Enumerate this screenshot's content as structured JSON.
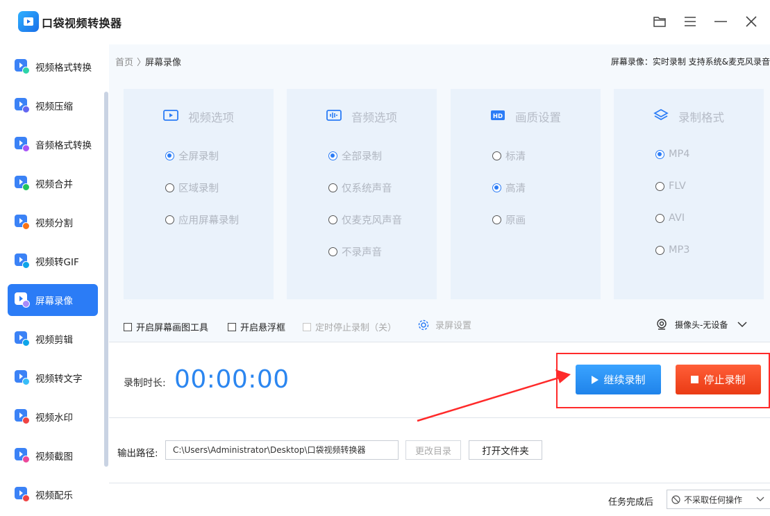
{
  "app": {
    "title": "口袋视频转换器"
  },
  "sidebar": {
    "items": [
      {
        "label": "视频格式转换",
        "color": "#3b82f6",
        "badge": "#2dd4a8"
      },
      {
        "label": "视频压缩",
        "color": "#3b82f6",
        "badge": "#6366f1"
      },
      {
        "label": "音频格式转换",
        "color": "#3b82f6",
        "badge": "#a855f7"
      },
      {
        "label": "视频合并",
        "color": "#3b82f6",
        "badge": "#22c55e"
      },
      {
        "label": "视频分割",
        "color": "#3b82f6",
        "badge": "#f97316"
      },
      {
        "label": "视频转GIF",
        "color": "#3b82f6",
        "badge": "#0ea5e9"
      },
      {
        "label": "屏幕录像",
        "color": "#ffffff",
        "badge": "#a78bfa"
      },
      {
        "label": "视频剪辑",
        "color": "#3b82f6",
        "badge": "#0ea5e9"
      },
      {
        "label": "视频转文字",
        "color": "#3b82f6",
        "badge": "#38bdf8"
      },
      {
        "label": "视频水印",
        "color": "#3b82f6",
        "badge": "#ef4444"
      },
      {
        "label": "视频截图",
        "color": "#3b82f6",
        "badge": "#ec4899"
      },
      {
        "label": "视频配乐",
        "color": "#3b82f6",
        "badge": "#ef4444"
      }
    ],
    "active_index": 6
  },
  "breadcrumb": {
    "home": "首页",
    "separator": "〉",
    "current": "屏幕录像"
  },
  "header_note": "屏幕录像：实时录制 支持系统&麦克风录音",
  "cards": {
    "video": {
      "title": "视频选项",
      "icon": "play-box-icon",
      "options": [
        "全屏录制",
        "区域录制",
        "应用屏幕录制"
      ],
      "selected": 0
    },
    "audio": {
      "title": "音频选项",
      "icon": "audio-wave-icon",
      "options": [
        "全部录制",
        "仅系统声音",
        "仅麦克风声音",
        "不录声音"
      ],
      "selected": 0
    },
    "quality": {
      "title": "画质设置",
      "icon": "hd-icon",
      "options": [
        "标清",
        "高清",
        "原画"
      ],
      "selected": 1
    },
    "format": {
      "title": "录制格式",
      "icon": "layers-icon",
      "options": [
        "MP4",
        "FLV",
        "AVI",
        "MP3"
      ],
      "selected": 0
    }
  },
  "toolbar": {
    "draw_tool": "开启屏幕画图工具",
    "float_frame": "开启悬浮框",
    "timed_stop": "定时停止录制（关）",
    "rec_settings": "录屏设置",
    "camera": "摄像头-无设备"
  },
  "recording": {
    "duration_label": "录制时长:",
    "duration_value": "00:00:00",
    "continue_label": "继续录制",
    "stop_label": "停止录制"
  },
  "output": {
    "label": "输出路径:",
    "path": "C:\\Users\\Administrator\\Desktop\\口袋视频转换器",
    "change_label": "更改目录",
    "open_label": "打开文件夹"
  },
  "task": {
    "label": "任务完成后",
    "selected": "不采取任何操作"
  },
  "colors": {
    "accent": "#2b7cf6",
    "timer": "#2b86f0",
    "stop": "#ea3b14",
    "highlight": "#ff2a2a"
  }
}
